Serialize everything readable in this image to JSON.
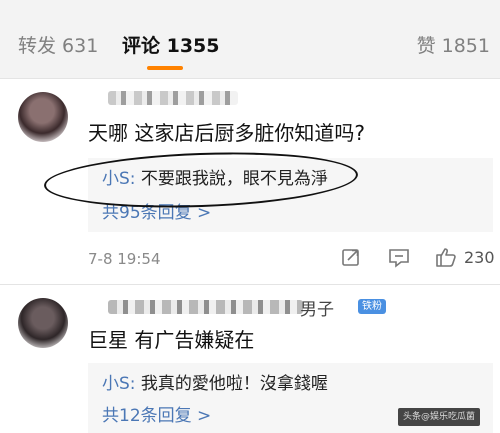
{
  "tabs": {
    "repost": "转发 631",
    "comment": "评论 1355",
    "like": "赞 1851"
  },
  "accent_color": "#ff8200",
  "link_color": "#4b77b5",
  "comments": [
    {
      "text": "天哪 这家店后厨多脏你知道吗?",
      "reply_author": "小S:",
      "reply_text": " 不要跟我說，眼不見為淨",
      "reply_more": "共95条回复 >",
      "timestamp": "7-8 19:54",
      "like_count": "230"
    },
    {
      "name_fragment": "男子",
      "badge": "铁粉",
      "text": "巨星 有广告嫌疑在",
      "reply_author": "小S:",
      "reply_text": " 我真的愛他啦！沒拿錢喔",
      "reply_more": "共12条回复 >"
    }
  ],
  "icons": {
    "share": "share-icon",
    "reply": "comment-icon",
    "like": "thumbs-up-icon"
  },
  "watermark": "头条@娱乐吃瓜菌"
}
